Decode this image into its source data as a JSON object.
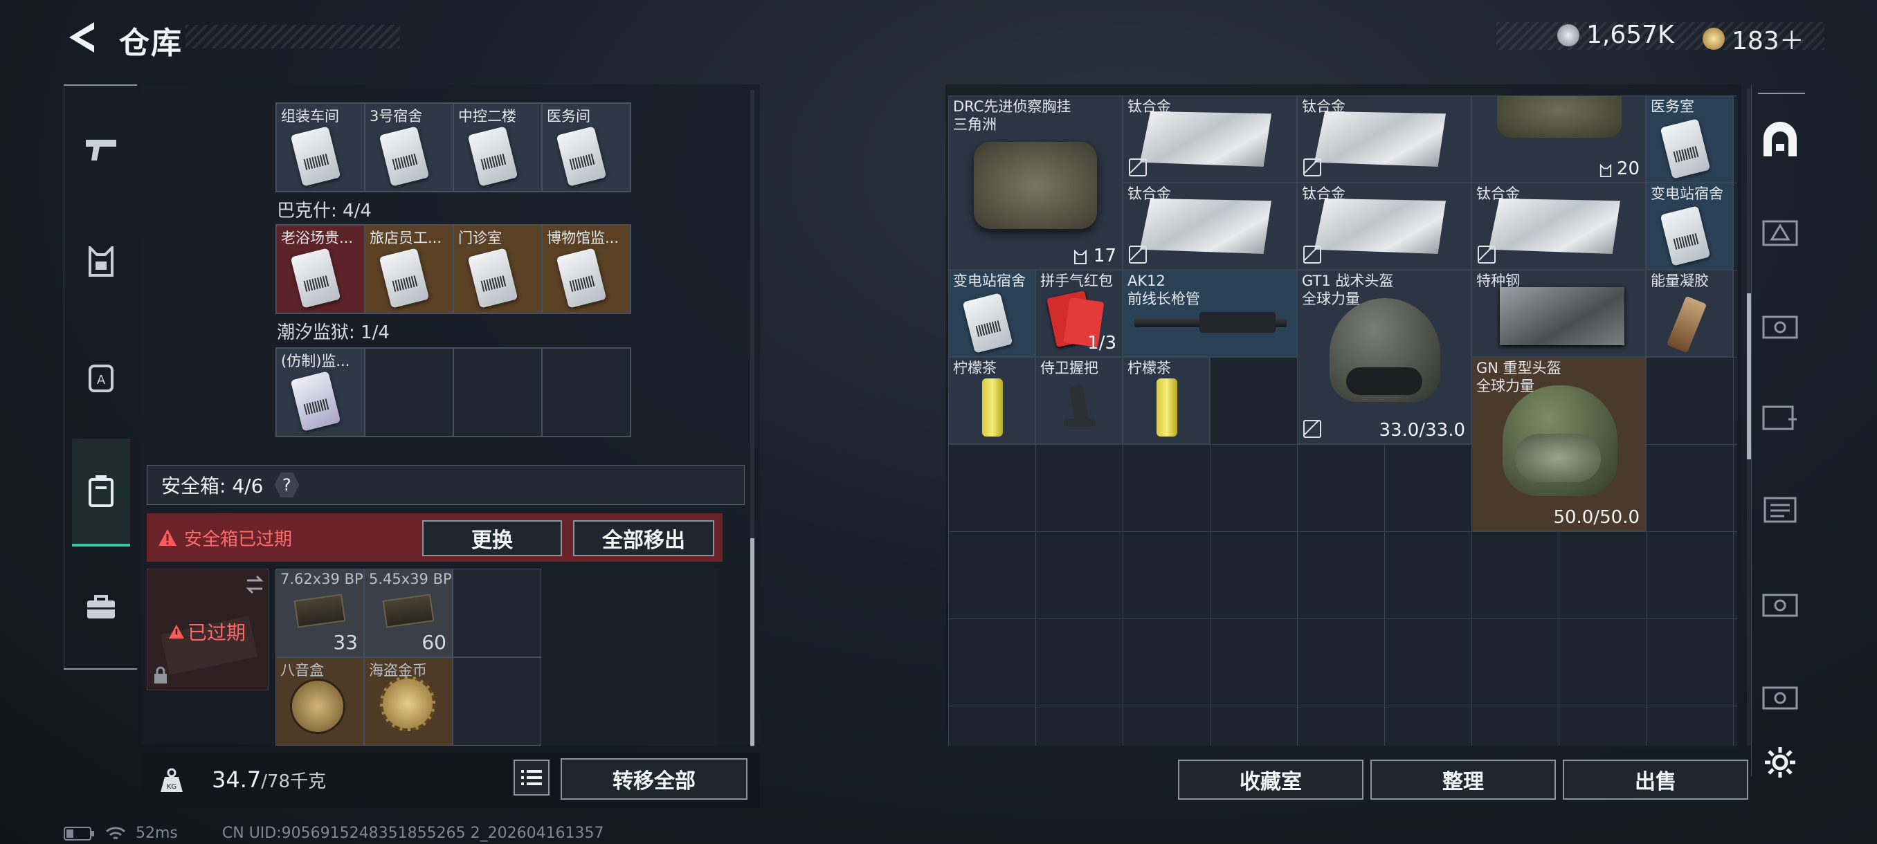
{
  "header": {
    "title": "仓库"
  },
  "currency": {
    "silver": "1,657K",
    "gold": "183＋"
  },
  "left": {
    "row1": [
      {
        "label": "组装车间"
      },
      {
        "label": "3号宿舍"
      },
      {
        "label": "中控二楼"
      },
      {
        "label": "医务间"
      }
    ],
    "section_bakeshi": "巴克什: 4/4",
    "row2": [
      {
        "label": "老浴场贵..."
      },
      {
        "label": "旅店员工..."
      },
      {
        "label": "门诊室"
      },
      {
        "label": "博物馆监..."
      }
    ],
    "section_prison": "潮汐监狱: 1/4",
    "row3": [
      {
        "label": "(仿制)监..."
      }
    ]
  },
  "safebox": {
    "title": "安全箱: 4/6",
    "help": "?",
    "expired_text": "安全箱已过期",
    "replace_btn": "更换",
    "move_all_btn": "全部移出",
    "expired_badge": "已过期",
    "items": [
      {
        "label": "7.62x39 BP",
        "count": "33"
      },
      {
        "label": "5.45x39 BP",
        "count": "60"
      },
      {
        "label": "八音盒",
        "count": ""
      },
      {
        "label": "海盗金币",
        "count": ""
      }
    ]
  },
  "weight": {
    "current": "34.7",
    "max": "/78千克",
    "transfer_btn": "转移全部"
  },
  "status": {
    "ping": "52ms",
    "uid": "CN UID:9056915248351855265 2_202604161357"
  },
  "right": {
    "items": {
      "drc": {
        "label": "DRC先进侦察胸挂\n三角洲",
        "count": "17"
      },
      "ti1": "钛合金",
      "ti2": "钛合金",
      "ti3": "钛合金",
      "ti4": "钛合金",
      "ti5": "钛合金",
      "bag_count": "20",
      "med1": "医务室",
      "sub1": "变电站宿舍",
      "sub2": "变电站宿舍",
      "redpack": {
        "label": "拼手气红包",
        "count": "1/3"
      },
      "ak12": "AK12\n前线长枪管",
      "gt1": {
        "label": "GT1 战术头盔\n全球力量",
        "count": "33.0/33.0"
      },
      "steel": "特种钢",
      "gel": "能量凝胶",
      "tea1": "柠檬茶",
      "grip": "侍卫握把",
      "tea2": "柠檬茶",
      "gn": {
        "label": "GN 重型头盔\n全球力量",
        "count": "50.0/50.0"
      }
    },
    "buttons": {
      "collection": "收藏室",
      "sort": "整理",
      "sell": "出售"
    }
  }
}
